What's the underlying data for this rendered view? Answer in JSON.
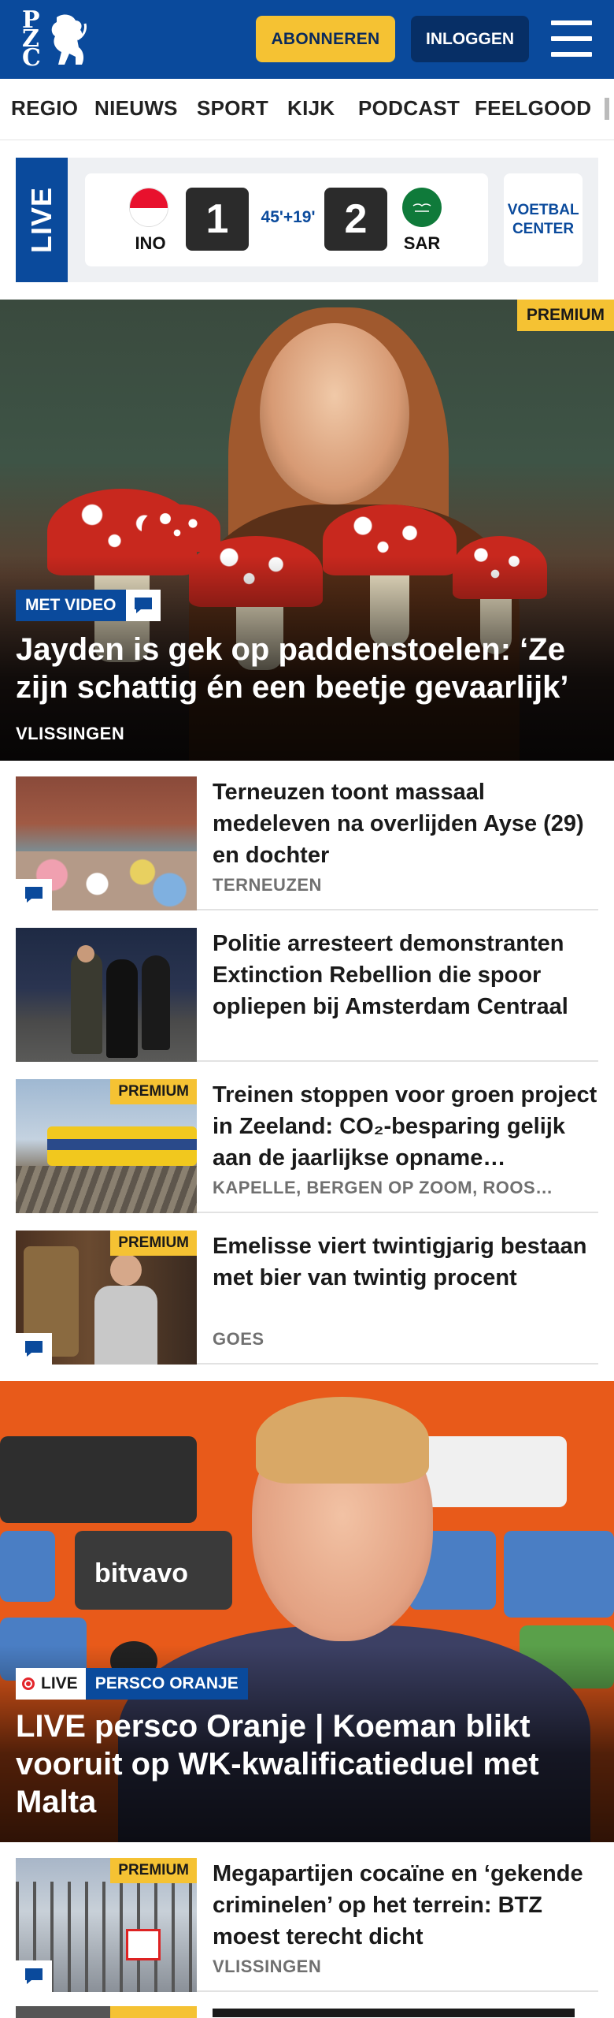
{
  "header": {
    "logo_letters": "PZC",
    "subscribe_label": "ABONNEREN",
    "login_label": "INLOGGEN"
  },
  "nav": {
    "items": [
      "REGIO",
      "NIEUWS",
      "SPORT",
      "KIJK",
      "PODCAST",
      "FEELGOOD"
    ]
  },
  "live": {
    "tag": "LIVE",
    "home_team": "INO",
    "away_team": "SAR",
    "home_score": "1",
    "away_score": "2",
    "minute": "45'+19'",
    "voetbal_center": "VOETBAL CENTER"
  },
  "hero": {
    "premium": "PREMIUM",
    "video_label": "MET VIDEO",
    "title": "Jayden is gek op paddenstoelen: ‘Ze zijn schattig én een beetje gevaarlijk’",
    "location": "VLISSINGEN"
  },
  "articles": [
    {
      "title": "Terneuzen toont massaal medeleven na overlijden Ayse (29) en dochter",
      "location": "TERNEUZEN",
      "premium": "",
      "has_comments": true
    },
    {
      "title": "Politie arresteert demonstranten Extinction Rebellion die spoor opliepen bij Amsterdam Centraal",
      "location": "",
      "premium": "",
      "has_comments": false
    },
    {
      "title": "Treinen stoppen voor groen project in Zeeland: CO₂-besparing gelijk aan de jaarlijkse opname…",
      "location": "KAPELLE, BERGEN OP ZOOM, ROOS…",
      "premium": "PREMIUM",
      "has_comments": false
    },
    {
      "title": "Emelisse viert twintigjarig bestaan met bier van twintig procent",
      "location": "GOES",
      "premium": "PREMIUM",
      "has_comments": true
    }
  ],
  "hero2": {
    "live_label": "LIVE",
    "tag": "PERSCO ORANJE",
    "title": "LIVE persco Oranje | Koeman blikt vooruit op WK-kwalificatieduel met Malta"
  },
  "article_after": {
    "title": "Megapartijen cocaïne en ‘gekende criminelen’ op het terrein: BTZ moest terecht dicht",
    "location": "VLISSINGEN",
    "premium": "PREMIUM"
  },
  "colors": {
    "brand_blue": "#0a4a9c",
    "accent_yellow": "#f5c233",
    "live_red": "#e3262b"
  }
}
